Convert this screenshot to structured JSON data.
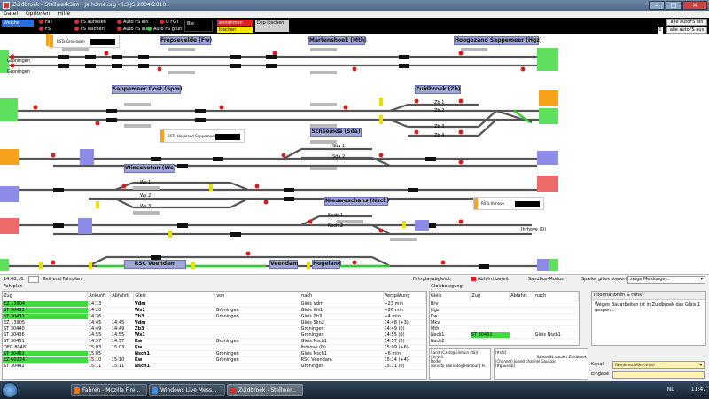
{
  "window": {
    "title": "Zuidbroek - StellwerkSim - js-home.org - (c) JS 2004-2010"
  },
  "menu": [
    "Datei",
    "Optionen",
    "Hilfe"
  ],
  "controls": {
    "items": [
      "Weiche",
      "FaT",
      "FS",
      "FS auflösen",
      "FS löschen",
      "Auto FS ein",
      "Auto FS aus",
      "Auto FS grün",
      "U FGT",
      "Blo",
      "annehmen",
      "löschen",
      "Dsp löschen"
    ],
    "auto_fs_all_on": "alle autoFS ein",
    "auto_fs_all_off": "alle autoFS aus",
    "counter": "0"
  },
  "stations": {
    "frepsevelde": "Frepsevelde (Fw)",
    "martenshoek": "Martenshoek (Mth)",
    "hogezand": "Hoogezand Sappemeer (Hgz)",
    "sappemeer_oost": "Sappemeer Oost (Spm)",
    "zuidbroek": "Zuidbroek (Zb)",
    "scheemda": "Scheemda (Sda)",
    "winschoten": "Winschoten (Ws)",
    "nieuweschans": "Nieuweschans (Nsch)",
    "rsc_veendam": "RSC Veendam",
    "veendam": "Veendam",
    "hogezand2": "Hogeland"
  },
  "place_labels": {
    "groningen1": "Groningen",
    "groningen2": "Groningen",
    "ihrhove": "Ihrhove (D)"
  },
  "track_labels": [
    "Zb 1",
    "Zb 2",
    "Zb 3",
    "Zb 4",
    "Sda 1",
    "Sda 2",
    "Ws 1",
    "Ws 2",
    "Ws 3",
    "Nsch 1",
    "Nsch 2"
  ],
  "notes": {
    "n1": "RSTa Groningen",
    "n2": "RSTa Hogeland Sappemeer NS-V8",
    "n3": "RSTa Ihrhove"
  },
  "status": {
    "time": "14:48:18",
    "fields_label": "Zeit und Fahrplan",
    "fahrplan": "Fahrplanabgleich",
    "abfahrt": "Abfahrt bereit",
    "sandbox": "Sandbox-Modus",
    "spieler": "Spieler gilles steuert",
    "dropdown": "zeige Meldungen"
  },
  "trains": {
    "title": "Fahrplan",
    "headers": [
      "Zug",
      "Ankunft",
      "Abfahrt",
      "Gleis",
      "von",
      "nach",
      "Verspätung"
    ],
    "rows": [
      [
        "EZ 13904",
        "14:13",
        "",
        "Vdm",
        "",
        "Gleis Vdm",
        "+23 min"
      ],
      [
        "ST 30433",
        "14:20",
        "",
        "Ws1",
        "Groningen",
        "Gleis Ws1",
        "+26 min"
      ],
      [
        "ST 30437",
        "14:36",
        "",
        "Zb3",
        "Groningen",
        "Gleis Zb3",
        "+4 min"
      ],
      [
        "EZ 13905",
        "14:45",
        "14:45",
        "Vdm",
        "",
        "Gleis Skn2",
        "14:48 (+3)"
      ],
      [
        "ST 30440",
        "14:49",
        "14:49",
        "Zb3",
        "",
        "Groningen",
        "14:49 (0)"
      ],
      [
        "ST 30436",
        "14:55",
        "14:55",
        "Ws1",
        "",
        "Groningen",
        "14:55 (0)"
      ],
      [
        "ST 30451",
        "14:57",
        "14:57",
        "Kw",
        "Groningen",
        "Gleis Nsch1",
        "14:57 (0)"
      ],
      [
        "DFG 80481",
        "15:03",
        "15:03",
        "Kw",
        "",
        "Ihrhove (D)",
        "15:09 (+6)"
      ],
      [
        "ST 30461",
        "15:05",
        "",
        "Nsch1",
        "Groningen",
        "Gleis Nsch1",
        "+6 min"
      ],
      [
        "EZ 60224",
        "15:10",
        "15:10",
        "Kw",
        "Groningen",
        "RSC Veendam",
        "15:14 (+4)"
      ],
      [
        "ST 30442",
        "15:11",
        "15:11",
        "Nsch1",
        "",
        "Groningen",
        "15:11 (0)"
      ]
    ],
    "highlight": [
      "green",
      "green",
      "green",
      "",
      "",
      "",
      "",
      "",
      "green",
      "green",
      ""
    ]
  },
  "tracks": {
    "title": "Gleisbelegung",
    "headers": [
      "Gleis",
      "Zug",
      "Abfahrt",
      "nach"
    ],
    "rows": [
      [
        "Brv",
        "",
        "",
        ""
      ],
      [
        "Hgz",
        "",
        "",
        ""
      ],
      [
        "Kw",
        "",
        "",
        ""
      ],
      [
        "Mkv",
        "",
        "",
        ""
      ],
      [
        "Mth",
        "",
        "",
        ""
      ],
      [
        "Nsch1",
        "ST 30461",
        "",
        "Gleis Nsch1"
      ],
      [
        "Nsch2",
        "",
        "",
        ""
      ]
    ]
  },
  "info": {
    "title": "Informationen & Funk",
    "message": "Wegen Bauarbeiten ist in Zuidbroek das Gleis 1 gesperrt."
  },
  "chat": {
    "users": [
      "Carst (Carst@Emhuin (Ya))",
      "Chrys4",
      "Dolfel",
      "dorvato (dorvato@Hamburg H..."
    ],
    "log": [
      "[#sts]",
      "SanderNL steuert Zuidbroek",
      "[Channel] Joined channel Gausaal",
      "[#gausaal]"
    ],
    "kanal_label": "Kanal",
    "kanal_value": "Fahrdienstleiter (#sts)",
    "eingabe_label": "Eingabe",
    "eingabe_value": ""
  },
  "taskbar": {
    "buttons": [
      "Fahren - Mozilla Fire...",
      "Windows Live Mess...",
      "Zuidbroek - Stellwer..."
    ],
    "lang": "NL",
    "clock": "11:47"
  }
}
